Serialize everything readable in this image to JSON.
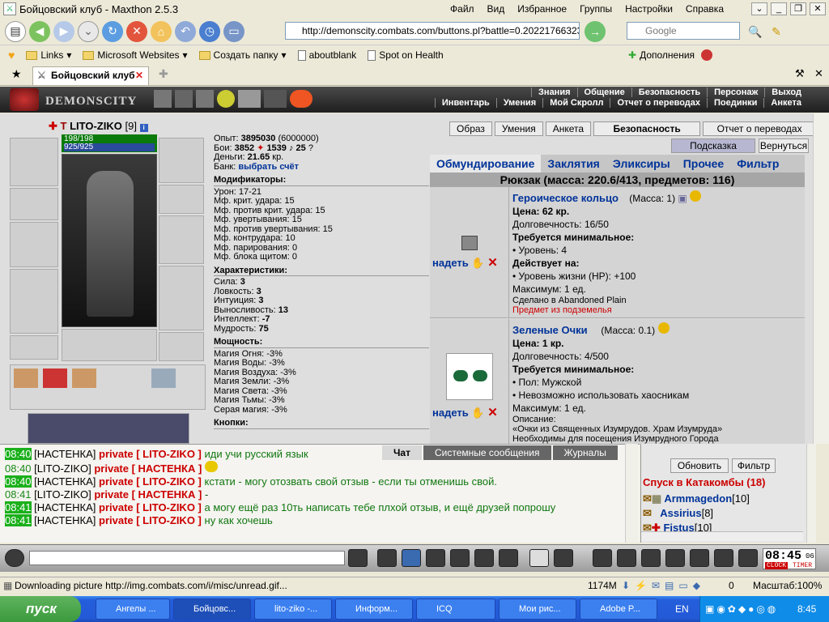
{
  "window": {
    "title": "Бойцовский клуб - Maxthon 2.5.3",
    "menu": [
      "Файл",
      "Вид",
      "Избранное",
      "Группы",
      "Настройки",
      "Справка"
    ]
  },
  "toolbar": {
    "address": "http://demonscity.combats.com/buttons.pl?battle=0.20221766323",
    "search_placeholder": "Google"
  },
  "links": [
    "Links",
    "Microsoft Websites",
    "Создать папку",
    "aboutblank",
    "Spot on Health"
  ],
  "addons_label": "Дополнения",
  "tab_title": "Бойцовский клуб",
  "game": {
    "logo": "DEMONSCITY",
    "nav_row1": [
      "Знания",
      "Общение",
      "Безопасность",
      "Персонаж",
      "Выход"
    ],
    "nav_row2": [
      "Инвентарь",
      "Умения",
      "Мой Скролл",
      "Отчет о переводах",
      "Поединки",
      "Анкета"
    ],
    "char_name": "LITO-ZIKO",
    "char_level": "[9]",
    "hp": "198/198",
    "mp": "925/925",
    "exp_label": "Опыт:",
    "exp_value": "3895030",
    "exp_next": "(6000000)",
    "battles_label": "Бои:",
    "battles_win": "3852",
    "battles_loss": "1539",
    "battles_draw": "25",
    "money_label": "Деньги:",
    "money_value": "21.65",
    "money_unit": "кр.",
    "bank_label": "Банк:",
    "bank_link": "выбрать счёт",
    "modifiers_title": "Модификаторы:",
    "modifiers": [
      "Урон: 17-21",
      "Мф. крит. удара: 15",
      "Мф. против крит. удара: 15",
      "Мф. увертывания: 15",
      "Мф. против увертывания: 15",
      "Мф. контрудара: 10",
      "Мф. парирования: 0",
      "Мф. блока щитом: 0"
    ],
    "stats_title": "Характеристики:",
    "stats": [
      {
        "label": "Сила:",
        "value": "3"
      },
      {
        "label": "Ловкость:",
        "value": "3"
      },
      {
        "label": "Интуиция:",
        "value": "3"
      },
      {
        "label": "Выносливость:",
        "value": "13"
      },
      {
        "label": "Интеллект:",
        "value": "-7"
      },
      {
        "label": "Мудрость:",
        "value": "75"
      }
    ],
    "power_title": "Мощность:",
    "power": [
      "Магия Огня: -3%",
      "Магия Воды: -3%",
      "Магия Воздуха: -3%",
      "Магия Земли: -3%",
      "Магия Света: -3%",
      "Магия Тьмы: -3%",
      "Серая магия: -3%"
    ],
    "buttons_title": "Кнопки:",
    "top_buttons": [
      "Образ",
      "Умения",
      "Анкета",
      "Безопасность",
      "Отчет о переводах"
    ],
    "hint_btn": "Подсказка",
    "back_btn": "Вернуться",
    "inv_tabs": [
      "Обмундирование",
      "Заклятия",
      "Эликсиры",
      "Прочее",
      "Фильтр"
    ],
    "backpack": "Рюкзак (масса: 220.6/413, предметов: 116)",
    "wear_label": "надеть",
    "items": [
      {
        "name": "Героическое кольцо",
        "mass": "(Масса: 1)",
        "price": "Цена: 62 кр.",
        "durability": "Долговечность: 16/50",
        "req_title": "Требуется минимальное:",
        "reqs": [
          "• Уровень: 4"
        ],
        "acts_title": "Действует на:",
        "acts": [
          "• Уровень жизни (HP): +100"
        ],
        "max": "Максимум: 1 ед.",
        "made": "Сделано в Abandoned Plain",
        "dungeon": "Предмет из подземелья"
      },
      {
        "name": "Зеленые Очки",
        "mass": "(Масса: 0.1)",
        "price": "Цена: 1 кр.",
        "durability": "Долговечность: 4/500",
        "req_title": "Требуется минимальное:",
        "reqs": [
          "• Пол: Мужской",
          "• Невозможно использовать хаосникам"
        ],
        "max": "Максимум: 1 ед.",
        "desc_title": "Описание:",
        "desc": [
          "«Очки из Священных Изумрудов. Храм Изумруда»",
          "Необходимы для посещения Изумрудного Города"
        ]
      }
    ]
  },
  "chat": {
    "tabs": [
      "Чат",
      "Системные сообщения",
      "Журналы"
    ],
    "lines": [
      {
        "time": "08:40",
        "from": "[НАСТЕНКА]",
        "priv": "private [ LITO-ZIKO ]",
        "text": "иди учи русский язык",
        "mine": false
      },
      {
        "time": "08:40",
        "from": "[LITO-ZIKO]",
        "priv": "private [ НАСТЕНКА ]",
        "text": "",
        "mine": true
      },
      {
        "time": "08:40",
        "from": "[НАСТЕНКА]",
        "priv": "private [ LITO-ZIKO ]",
        "text": "кстати - могу отозвать свой отзыв - если ты отменишь свой.",
        "mine": false
      },
      {
        "time": "08:41",
        "from": "[LITO-ZIKO]",
        "priv": "private [ НАСТЕНКА ]",
        "text": "-",
        "mine": true
      },
      {
        "time": "08:41",
        "from": "[НАСТЕНКА]",
        "priv": "private [ LITO-ZIKO ]",
        "text": "а могу ещё раз 10ть написать тебе плхой отзыв, и ещё друзей попрошу",
        "mine": false
      },
      {
        "time": "08:41",
        "from": "[НАСТЕНКА]",
        "priv": "private [ LITO-ZIKO ]",
        "text": "ну как хочешь",
        "mine": false
      }
    ]
  },
  "players": {
    "refresh": "Обновить",
    "filter": "Фильтр",
    "title": "Спуск в Катакомбы (18)",
    "list": [
      {
        "name": "Armmagedon",
        "level": "[10]"
      },
      {
        "name": "Assirius",
        "level": "[8]"
      },
      {
        "name": "Fistus",
        "level": "[10]"
      }
    ]
  },
  "clock": {
    "time": "08:45",
    "sec": "06",
    "label1": "CLOCK",
    "label2": "TIMER"
  },
  "status": {
    "text": "Downloading picture http://img.combats.com/i/misc/unread.gif...",
    "memory": "1174M",
    "count": "0",
    "zoom": "Масштаб:100%"
  },
  "taskbar": {
    "start": "пуск",
    "tasks": [
      "Ангелы ...",
      "Бойцовс...",
      "lito-ziko -...",
      "Информ...",
      "ICQ",
      "Мои рис...",
      "Adobe P..."
    ],
    "lang": "EN",
    "time": "8:45"
  }
}
